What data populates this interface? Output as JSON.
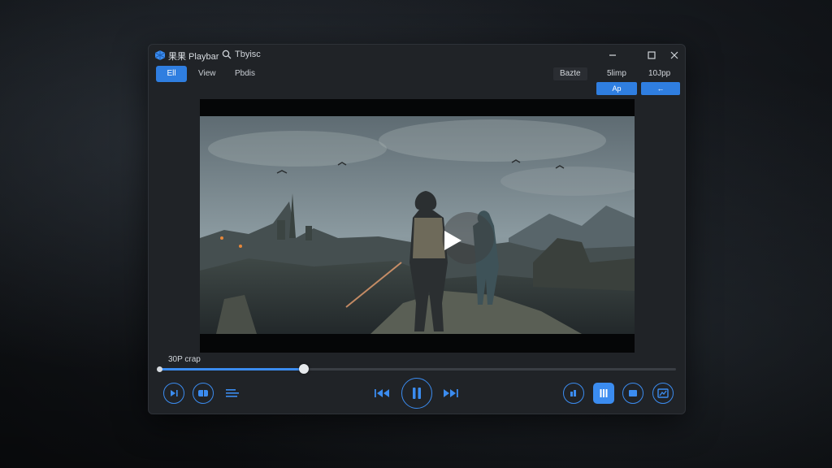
{
  "window": {
    "title": "果果 Playbar",
    "search_text": "Tbyisc",
    "controls": [
      "minimize",
      "maximize",
      "close"
    ]
  },
  "menu": {
    "items": [
      {
        "label": "Ell",
        "active": true
      },
      {
        "label": "View",
        "active": false
      },
      {
        "label": "Pbdis",
        "active": false
      }
    ]
  },
  "toolbar_right": {
    "chips": [
      "Bazte",
      "5limp",
      "10Jpp"
    ],
    "buttons": [
      "Ap",
      "←"
    ]
  },
  "player": {
    "time_label": "30P crap",
    "progress": 0.28,
    "accent": "#3b8cf0"
  },
  "controls": {
    "left": [
      "play-next-icon",
      "subtitle-icon",
      "playlist-icon"
    ],
    "center": [
      "rewind-icon",
      "pause-icon",
      "fast-forward-icon"
    ],
    "right": [
      "audio-icon",
      "equalizer-icon",
      "window-icon",
      "screenshot-icon"
    ]
  }
}
